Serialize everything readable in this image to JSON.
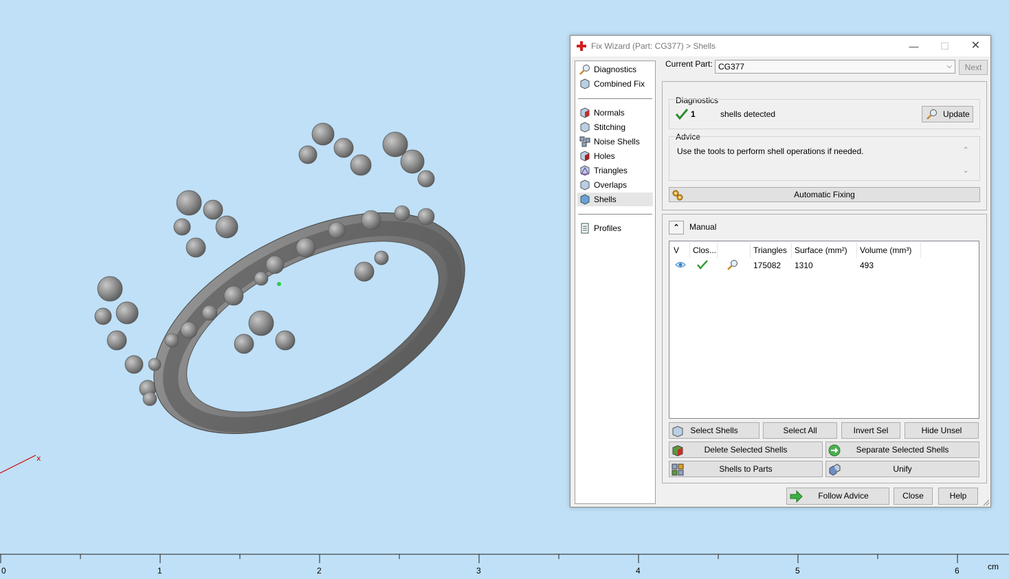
{
  "viewport": {
    "axis_label": "x",
    "ruler_numbers": [
      "0",
      "1",
      "2",
      "3",
      "4",
      "5",
      "6"
    ],
    "ruler_unit": "cm"
  },
  "dialog": {
    "title": "Fix Wizard (Part: CG377) > Shells",
    "window_buttons": {
      "minimize": "—",
      "maximize": "☐",
      "close": "✕"
    },
    "nav": {
      "top_items": [
        {
          "label": "Diagnostics",
          "icon": "magnifier-icon"
        },
        {
          "label": "Combined Fix",
          "icon": "cube-icon"
        }
      ],
      "fix_items": [
        {
          "label": "Normals",
          "icon": "normals-icon"
        },
        {
          "label": "Stitching",
          "icon": "stitching-icon"
        },
        {
          "label": "Noise Shells",
          "icon": "noise-shells-icon"
        },
        {
          "label": "Holes",
          "icon": "holes-icon"
        },
        {
          "label": "Triangles",
          "icon": "triangles-icon"
        },
        {
          "label": "Overlaps",
          "icon": "overlaps-icon"
        },
        {
          "label": "Shells",
          "icon": "shells-icon",
          "selected": true
        }
      ],
      "bottom_items": [
        {
          "label": "Profiles",
          "icon": "profiles-icon"
        }
      ]
    },
    "current_part": {
      "label": "Current Part:",
      "value": "CG377"
    },
    "next_label": "Next",
    "diagnostics": {
      "group_label": "Diagnostics",
      "count": "1",
      "text": "shells detected",
      "update_label": "Update"
    },
    "advice": {
      "group_label": "Advice",
      "text": "Use the tools to perform shell operations if needed."
    },
    "automatic_fixing_label": "Automatic Fixing",
    "manual": {
      "label": "Manual",
      "collapse_glyph": "⌃",
      "columns": [
        "V",
        "Clos...",
        "",
        "Triangles",
        "Surface (mm²)",
        "Volume (mm³)"
      ],
      "rows": [
        {
          "visible": "eye-icon",
          "closed": "check-icon",
          "inspect": "magnifier-icon",
          "triangles": "175082",
          "surface": "1310",
          "volume": "493"
        }
      ]
    },
    "buttons": {
      "select_shells": "Select Shells",
      "select_all": "Select All",
      "invert_sel": "Invert Sel",
      "hide_unsel": "Hide Unsel",
      "delete_selected": "Delete Selected Shells",
      "separate_selected": "Separate Selected Shells",
      "shells_to_parts": "Shells to Parts",
      "unify": "Unify",
      "follow_advice": "Follow Advice",
      "close": "Close",
      "help": "Help"
    }
  }
}
